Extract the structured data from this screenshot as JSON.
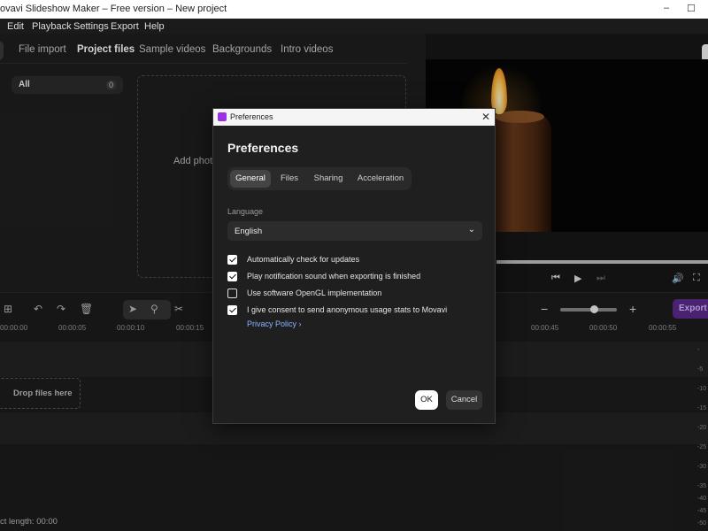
{
  "window": {
    "title": "ovavi Slideshow Maker – Free version – New project",
    "minimize": "–",
    "maximize": "☐"
  },
  "menu": [
    "Edit",
    "Playback",
    "Settings",
    "Export",
    "Help"
  ],
  "media_tabs": [
    {
      "label": "File import",
      "active": false
    },
    {
      "label": "Project files",
      "active": true
    },
    {
      "label": "Sample videos",
      "active": false
    },
    {
      "label": "Backgrounds",
      "active": false
    },
    {
      "label": "Intro videos",
      "active": false
    }
  ],
  "categories": [
    {
      "label": "All",
      "count": "0"
    }
  ],
  "dropzone_text": "Add photo",
  "preview_controls": {
    "prev": "⏮",
    "play": "▶",
    "next": "⏭",
    "volume": "🔊",
    "fullscreen": "⛶"
  },
  "toolbar": {
    "export_label": "Export",
    "zoom_minus": "−",
    "zoom_plus": "+",
    "zoom_level": 0.6
  },
  "ruler_ticks": [
    "00:00:00",
    "00:00:05",
    "00:00:10",
    "00:00:15",
    "00:00:45",
    "00:00:50",
    "00:00:55"
  ],
  "right_scale": [
    "-",
    "-5",
    "-10",
    "-15",
    "-20",
    "-25",
    "-30",
    "-35",
    "-40",
    "-45",
    "-50"
  ],
  "timeline": {
    "drop_files": "Drop files here"
  },
  "status": {
    "project_length": "ct length: 00:00"
  },
  "dialog": {
    "title": "Preferences",
    "heading": "Preferences",
    "close": "✕",
    "tabs": [
      {
        "label": "General",
        "active": true
      },
      {
        "label": "Files",
        "active": false
      },
      {
        "label": "Sharing",
        "active": false
      },
      {
        "label": "Acceleration",
        "active": false
      }
    ],
    "language_label": "Language",
    "language_value": "English",
    "options": [
      {
        "label": "Automatically check for updates",
        "checked": true
      },
      {
        "label": "Play notification sound when exporting is finished",
        "checked": true
      },
      {
        "label": "Use software OpenGL implementation",
        "checked": false
      },
      {
        "label": "I give consent to send anonymous usage stats to Movavi",
        "checked": true
      }
    ],
    "privacy_link": "Privacy Policy  ›",
    "ok_label": "OK",
    "cancel_label": "Cancel"
  }
}
